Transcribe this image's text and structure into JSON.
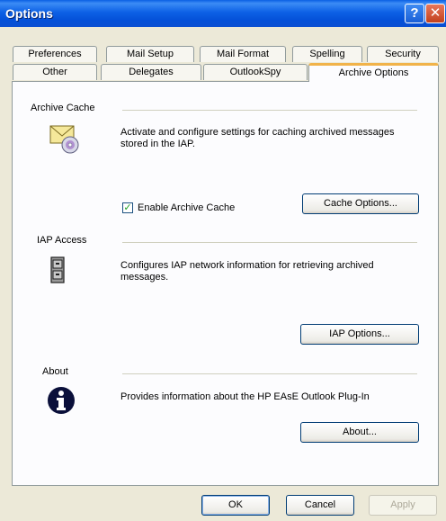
{
  "window": {
    "title": "Options",
    "help_glyph": "?",
    "close_glyph": "✕"
  },
  "tabs_row1": [
    "Preferences",
    "Mail Setup",
    "Mail Format",
    "Spelling",
    "Security"
  ],
  "tabs_row2": [
    "Other",
    "Delegates",
    "OutlookSpy",
    "Archive Options"
  ],
  "active_tab": "Archive Options",
  "archive_cache": {
    "title": "Archive Cache",
    "description": "Activate and configure settings for caching archived messages stored in the IAP.",
    "checkbox_label": "Enable Archive Cache",
    "checkbox_checked": true,
    "button_label": "Cache Options..."
  },
  "iap_access": {
    "title": "IAP Access",
    "description": "Configures IAP network information for retrieving archived messages.",
    "button_label": "IAP Options..."
  },
  "about": {
    "title": "About",
    "description": "Provides information about the HP EAsE Outlook Plug-In",
    "button_label": "About..."
  },
  "footer": {
    "ok_label": "OK",
    "cancel_label": "Cancel",
    "apply_label": "Apply"
  },
  "icons": {
    "archive_cache": "envelope-cd-icon",
    "iap_access": "file-cabinet-icon",
    "about": "info-icon"
  }
}
